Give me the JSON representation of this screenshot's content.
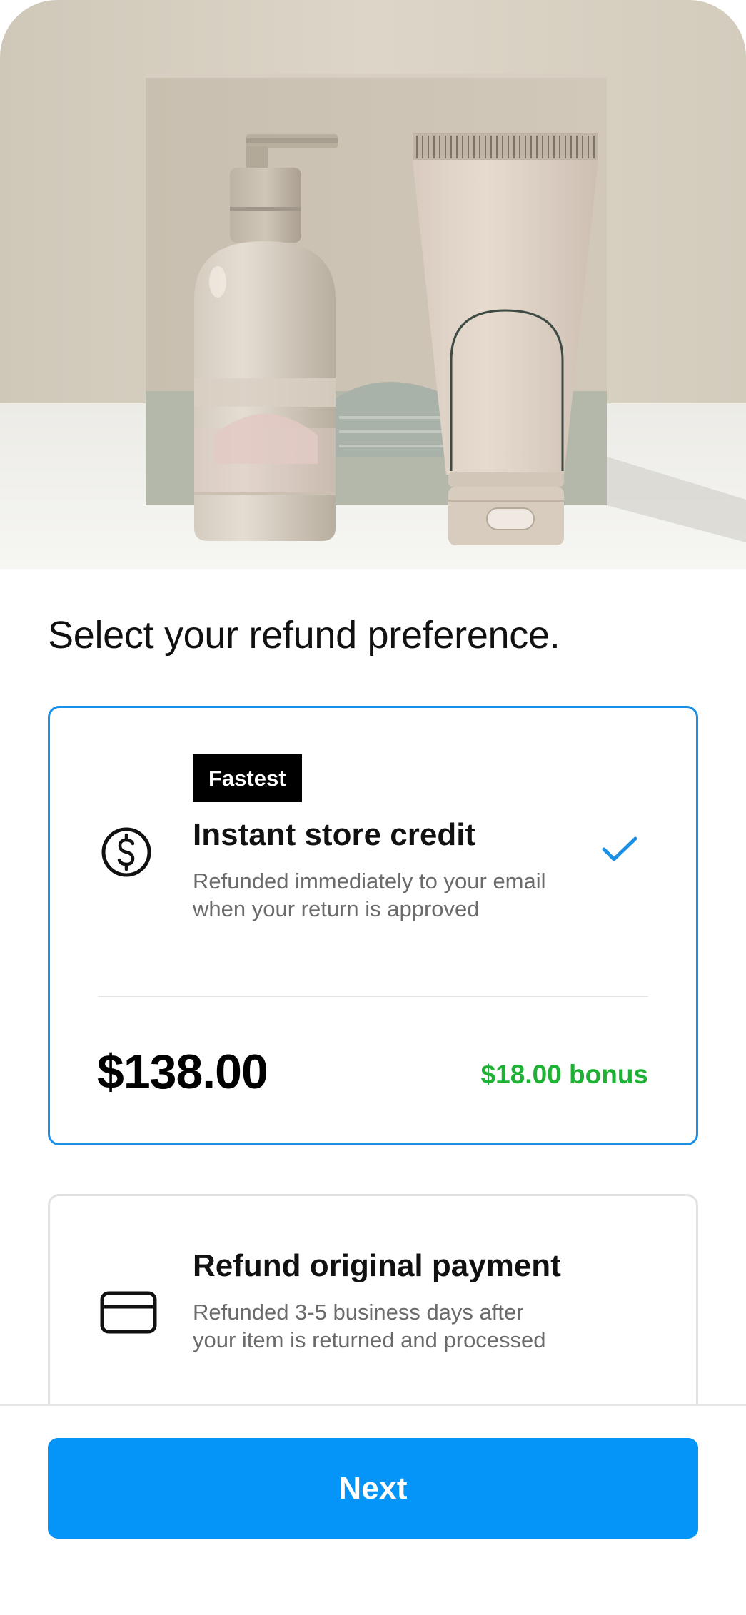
{
  "hero": {
    "image": "product-photo: pump bottle and cream tube in front of a box"
  },
  "heading": "Select your refund preference.",
  "options": [
    {
      "id": "store-credit",
      "badge": "Fastest",
      "icon": "dollar-circle-icon",
      "title": "Instant store credit",
      "description": "Refunded immediately to your email when your return is approved",
      "selected": true,
      "amount": "$138.00",
      "bonus": "$18.00 bonus"
    },
    {
      "id": "original-payment",
      "icon": "credit-card-icon",
      "title": "Refund original payment",
      "description": "Refunded 3-5 business days after your item is returned and processed",
      "selected": false
    }
  ],
  "footer": {
    "next_label": "Next"
  },
  "colors": {
    "accent": "#0594f7",
    "selected_border": "#1a8fe3",
    "bonus": "#1fb135",
    "badge_bg": "#000000"
  }
}
